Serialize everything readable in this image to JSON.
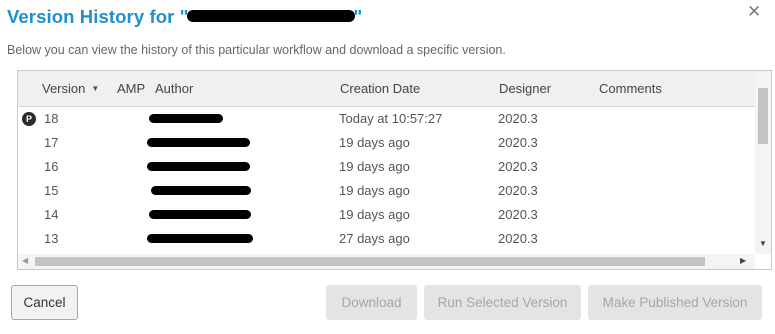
{
  "dialog": {
    "title_prefix": "Version History for \"",
    "title_suffix": "\"",
    "close_glyph": "✕",
    "subtitle": "Below you can view the history of this particular workflow and download a specific version."
  },
  "table": {
    "columns": {
      "version": "Version",
      "amp": "AMP",
      "author": "Author",
      "creation_date": "Creation Date",
      "designer": "Designer",
      "comments": "Comments"
    },
    "sort_indicator": "▼",
    "rows": [
      {
        "badge": "P",
        "version": "18",
        "amp": "",
        "author": "",
        "creation_date": "Today at 10:57:27",
        "designer": "2020.3",
        "comments": ""
      },
      {
        "badge": "",
        "version": "17",
        "amp": "",
        "author": "",
        "creation_date": "19 days ago",
        "designer": "2020.3",
        "comments": ""
      },
      {
        "badge": "",
        "version": "16",
        "amp": "",
        "author": "",
        "creation_date": "19 days ago",
        "designer": "2020.3",
        "comments": ""
      },
      {
        "badge": "",
        "version": "15",
        "amp": "",
        "author": "",
        "creation_date": "19 days ago",
        "designer": "2020.3",
        "comments": ""
      },
      {
        "badge": "",
        "version": "14",
        "amp": "",
        "author": "",
        "creation_date": "19 days ago",
        "designer": "2020.3",
        "comments": ""
      },
      {
        "badge": "",
        "version": "13",
        "amp": "",
        "author": "",
        "creation_date": "27 days ago",
        "designer": "2020.3",
        "comments": ""
      }
    ]
  },
  "buttons": {
    "cancel": "Cancel",
    "download": "Download",
    "run_selected": "Run Selected Version",
    "make_published": "Make Published Version"
  },
  "scrollbar_glyphs": {
    "down": "▼",
    "left": "◀",
    "right": "▶"
  },
  "colors": {
    "title": "#1e8fd0",
    "badge": "#2b2b2b",
    "disabled_button": "#e4e4e4"
  }
}
